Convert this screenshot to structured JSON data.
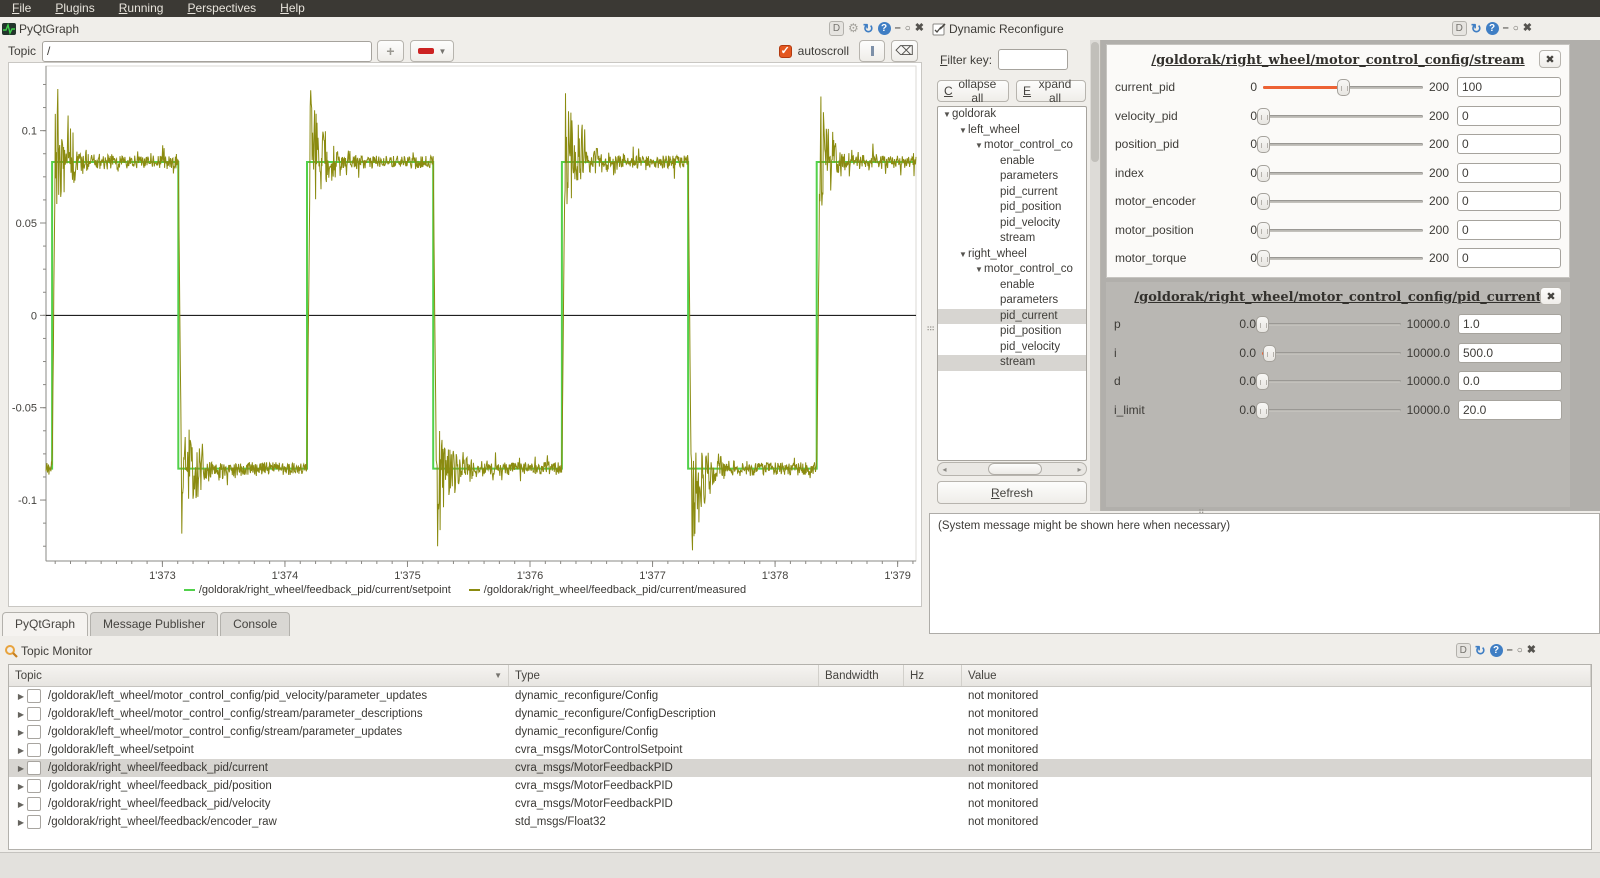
{
  "menubar": {
    "items": [
      "File",
      "Plugins",
      "Running",
      "Perspectives",
      "Help"
    ]
  },
  "window_controls": {
    "detach": "D",
    "gear": "⚙",
    "reload": "↻",
    "help": "?",
    "minimize": "–",
    "maximize": "○",
    "close": "✖"
  },
  "pyqtgraph": {
    "title": "PyQtGraph",
    "topic_label": "Topic",
    "topic_value": "/",
    "add_button": "+",
    "autoscroll_label": "autoscroll",
    "clear_glyph": "⌫",
    "tabs": [
      {
        "label": "PyQtGraph",
        "active": true
      },
      {
        "label": "Message Publisher",
        "active": false
      },
      {
        "label": "Console",
        "active": false
      }
    ]
  },
  "chart_data": {
    "type": "line",
    "title": "",
    "xlabel": "",
    "ylabel": "",
    "x_range": [
      1372.05,
      1379.15
    ],
    "y_range": [
      -0.133,
      0.135
    ],
    "x_ticks": [
      1373,
      1374,
      1375,
      1376,
      1377,
      1378,
      1379
    ],
    "x_tick_labels": [
      "1'373",
      "1'374",
      "1'375",
      "1'376",
      "1'377",
      "1'378",
      "1'379"
    ],
    "y_ticks": [
      0.1,
      0.05,
      0,
      -0.05,
      -0.1
    ],
    "y_tick_labels": [
      "0.1",
      "0.05",
      "0",
      "-0.05",
      "-0.1"
    ],
    "grid": false,
    "zero_line": true,
    "legend_position": "bottom",
    "series": [
      {
        "name": "/goldorak/right_wheel/feedback_pid/current/setpoint",
        "color": "#52d14b",
        "shape": "square_wave",
        "amplitude": 0.083,
        "initial_level": -0.083,
        "edges": [
          1372.1,
          1373.13,
          1374.18,
          1375.21,
          1376.26,
          1377.29,
          1378.34
        ]
      },
      {
        "name": "/goldorak/right_wheel/feedback_pid/current/measured",
        "color": "#8b8b10",
        "shape": "noisy_tracking",
        "tracks": "setpoint",
        "noise_sd": 0.0035,
        "overshoot_peak": 0.048,
        "overshoot_decay": 0.12,
        "max_observed": 0.128,
        "min_observed": -0.133
      }
    ]
  },
  "dynamic_reconfigure": {
    "title": "Dynamic Reconfigure",
    "filter_label": "Filter key:",
    "filter_value": "",
    "collapse_all": "Collapse all",
    "expand_all": "Expand all",
    "refresh": "Refresh",
    "tree": [
      {
        "label": "goldorak",
        "depth": 0,
        "expanded": true,
        "selected": false
      },
      {
        "label": "left_wheel",
        "depth": 1,
        "expanded": true,
        "selected": false
      },
      {
        "label": "motor_control_co",
        "depth": 2,
        "expanded": true,
        "selected": false
      },
      {
        "label": "enable",
        "depth": 3,
        "expanded": false,
        "selected": false
      },
      {
        "label": "parameters",
        "depth": 3,
        "expanded": false,
        "selected": false
      },
      {
        "label": "pid_current",
        "depth": 3,
        "expanded": false,
        "selected": false
      },
      {
        "label": "pid_position",
        "depth": 3,
        "expanded": false,
        "selected": false
      },
      {
        "label": "pid_velocity",
        "depth": 3,
        "expanded": false,
        "selected": false
      },
      {
        "label": "stream",
        "depth": 3,
        "expanded": false,
        "selected": false
      },
      {
        "label": "right_wheel",
        "depth": 1,
        "expanded": true,
        "selected": false
      },
      {
        "label": "motor_control_co",
        "depth": 2,
        "expanded": true,
        "selected": false
      },
      {
        "label": "enable",
        "depth": 3,
        "expanded": false,
        "selected": false
      },
      {
        "label": "parameters",
        "depth": 3,
        "expanded": false,
        "selected": false
      },
      {
        "label": "pid_current",
        "depth": 3,
        "expanded": false,
        "selected": true
      },
      {
        "label": "pid_position",
        "depth": 3,
        "expanded": false,
        "selected": false
      },
      {
        "label": "pid_velocity",
        "depth": 3,
        "expanded": false,
        "selected": false
      },
      {
        "label": "stream",
        "depth": 3,
        "expanded": false,
        "selected": true
      }
    ],
    "panels": [
      {
        "title": "/goldorak/right_wheel/motor_control_config/stream",
        "style": "light",
        "rows": [
          {
            "label": "current_pid",
            "min": "0",
            "max": "200",
            "value": "100",
            "percent": 50
          },
          {
            "label": "velocity_pid",
            "min": "0",
            "max": "200",
            "value": "0",
            "percent": 0
          },
          {
            "label": "position_pid",
            "min": "0",
            "max": "200",
            "value": "0",
            "percent": 0
          },
          {
            "label": "index",
            "min": "0",
            "max": "200",
            "value": "0",
            "percent": 0
          },
          {
            "label": "motor_encoder",
            "min": "0",
            "max": "200",
            "value": "0",
            "percent": 0
          },
          {
            "label": "motor_position",
            "min": "0",
            "max": "200",
            "value": "0",
            "percent": 0
          },
          {
            "label": "motor_torque",
            "min": "0",
            "max": "200",
            "value": "0",
            "percent": 0
          }
        ]
      },
      {
        "title": "/goldorak/right_wheel/motor_control_config/pid_current",
        "style": "gray",
        "rows": [
          {
            "label": "p",
            "min": "0.0",
            "max": "10000.0",
            "value": "1.0",
            "percent": 0
          },
          {
            "label": "i",
            "min": "0.0",
            "max": "10000.0",
            "value": "500.0",
            "percent": 5
          },
          {
            "label": "d",
            "min": "0.0",
            "max": "10000.0",
            "value": "0.0",
            "percent": 0
          },
          {
            "label": "i_limit",
            "min": "0.0",
            "max": "10000.0",
            "value": "20.0",
            "percent": 0.2
          }
        ]
      }
    ],
    "system_message": "(System message might be shown here when necessary)"
  },
  "topic_monitor": {
    "title": "Topic Monitor",
    "columns": [
      "Topic",
      "Type",
      "Bandwidth",
      "Hz",
      "Value"
    ],
    "rows": [
      {
        "topic": "/goldorak/left_wheel/motor_control_config/pid_velocity/parameter_updates",
        "type": "dynamic_reconfigure/Config",
        "bandwidth": "",
        "hz": "",
        "value": "not monitored",
        "selected": false
      },
      {
        "topic": "/goldorak/left_wheel/motor_control_config/stream/parameter_descriptions",
        "type": "dynamic_reconfigure/ConfigDescription",
        "bandwidth": "",
        "hz": "",
        "value": "not monitored",
        "selected": false
      },
      {
        "topic": "/goldorak/left_wheel/motor_control_config/stream/parameter_updates",
        "type": "dynamic_reconfigure/Config",
        "bandwidth": "",
        "hz": "",
        "value": "not monitored",
        "selected": false
      },
      {
        "topic": "/goldorak/left_wheel/setpoint",
        "type": "cvra_msgs/MotorControlSetpoint",
        "bandwidth": "",
        "hz": "",
        "value": "not monitored",
        "selected": false
      },
      {
        "topic": "/goldorak/right_wheel/feedback_pid/current",
        "type": "cvra_msgs/MotorFeedbackPID",
        "bandwidth": "",
        "hz": "",
        "value": "not monitored",
        "selected": true
      },
      {
        "topic": "/goldorak/right_wheel/feedback_pid/position",
        "type": "cvra_msgs/MotorFeedbackPID",
        "bandwidth": "",
        "hz": "",
        "value": "not monitored",
        "selected": false
      },
      {
        "topic": "/goldorak/right_wheel/feedback_pid/velocity",
        "type": "cvra_msgs/MotorFeedbackPID",
        "bandwidth": "",
        "hz": "",
        "value": "not monitored",
        "selected": false
      },
      {
        "topic": "/goldorak/right_wheel/feedback/encoder_raw",
        "type": "std_msgs/Float32",
        "bandwidth": "",
        "hz": "",
        "value": "not monitored",
        "selected": false
      }
    ]
  },
  "colors": {
    "accent_orange": "#ed6234",
    "checkbox_orange": "#e4571f",
    "setpoint_green": "#52d14b",
    "measured_olive": "#8b8b10",
    "selection_gray": "#d7d5d1",
    "menubar_bg": "#3b3934"
  }
}
